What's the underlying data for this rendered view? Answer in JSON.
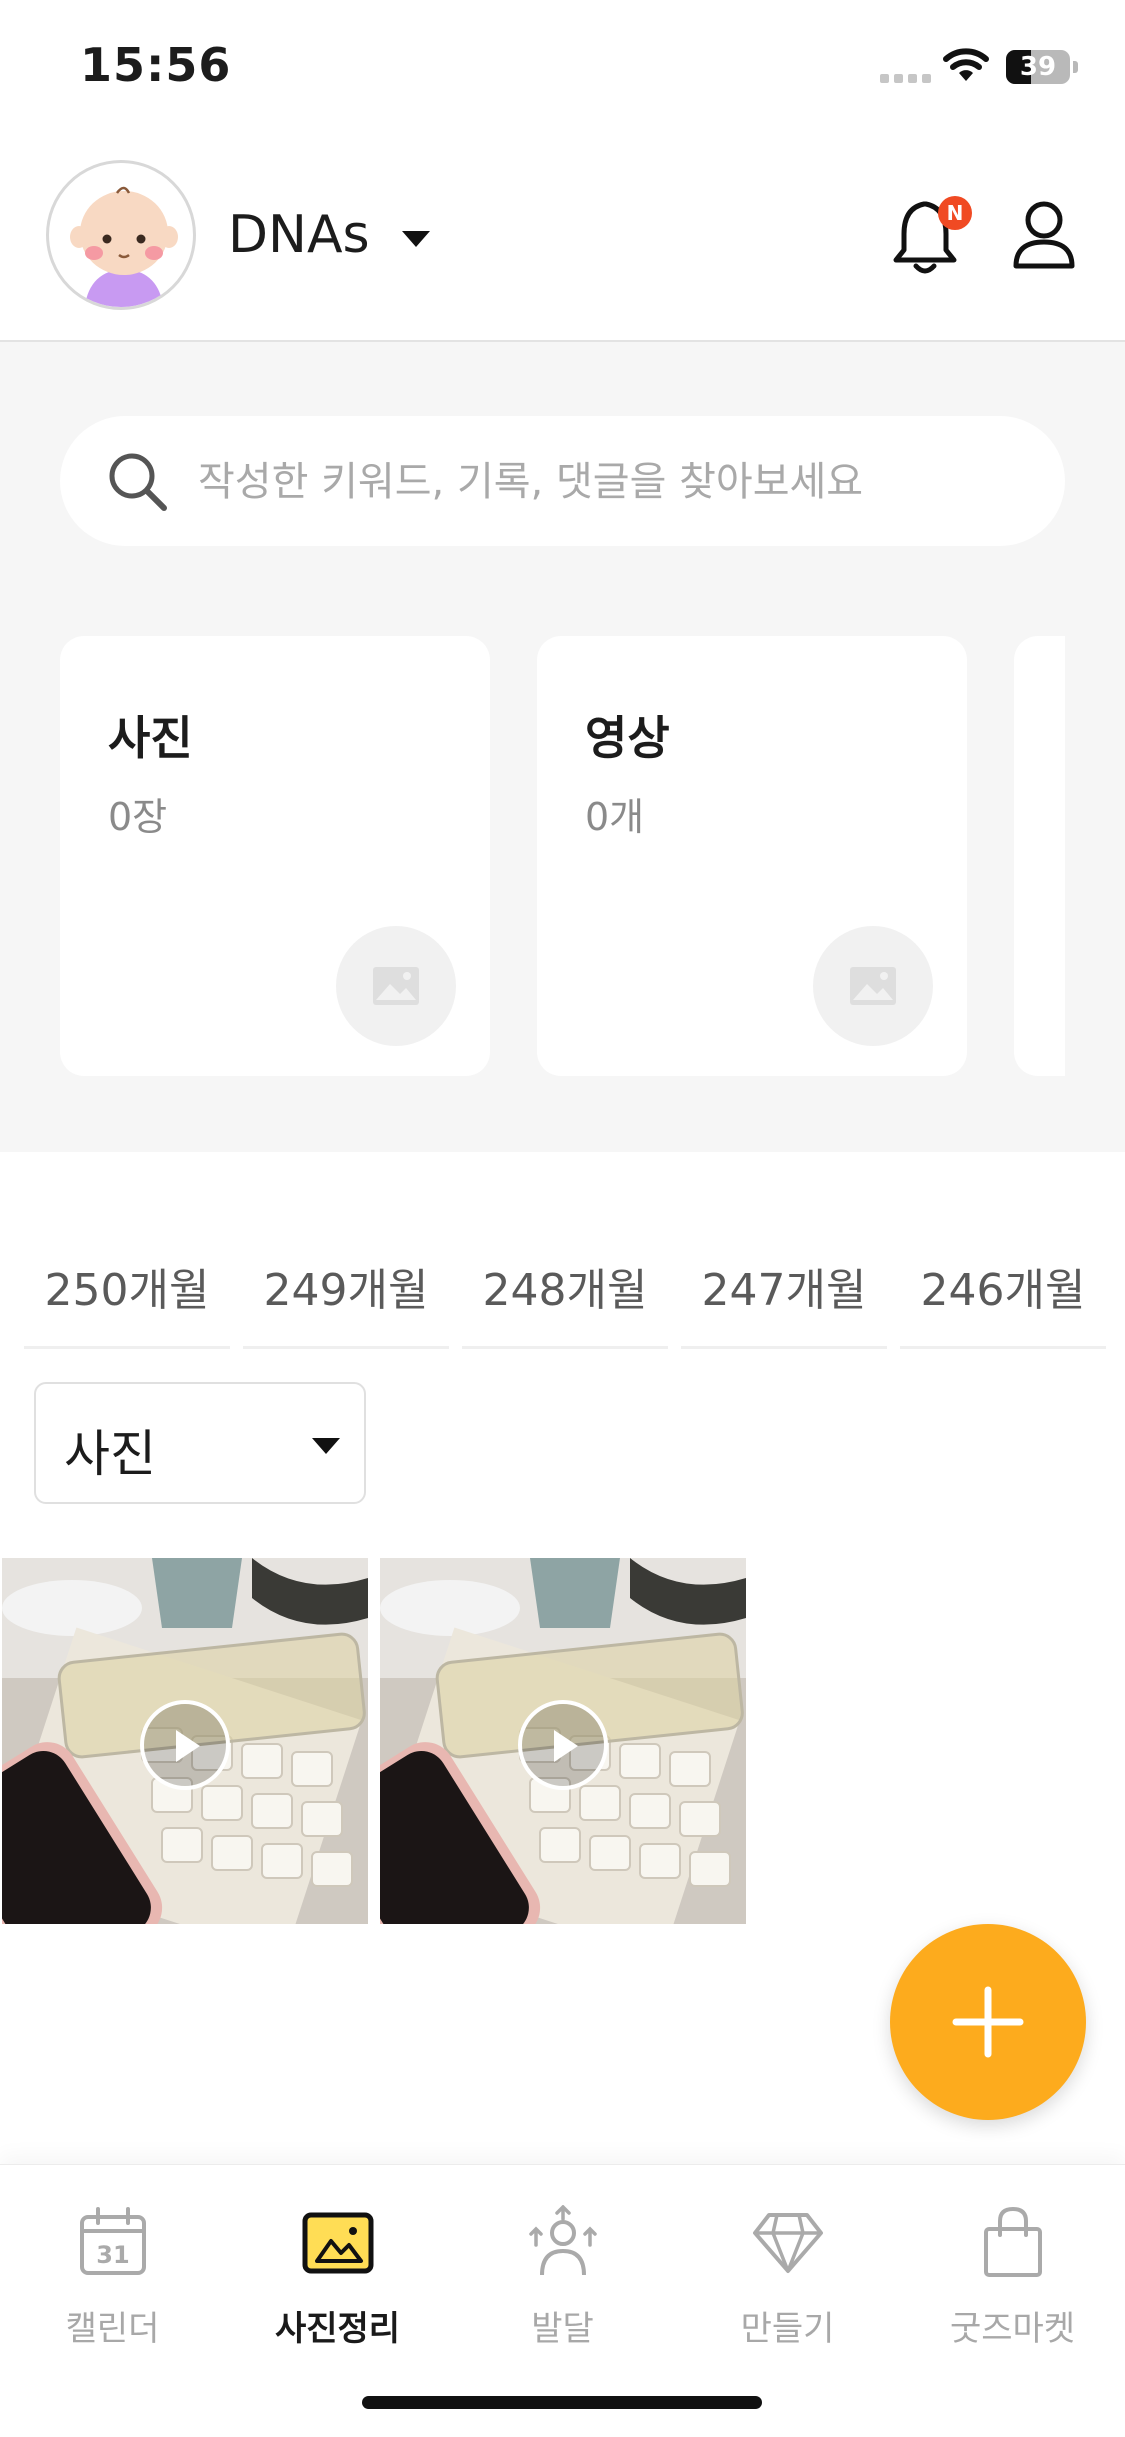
{
  "status_bar": {
    "time": "15:56",
    "battery": "39"
  },
  "header": {
    "profile_name": "DNAs",
    "notification_badge": "N"
  },
  "search": {
    "placeholder": "작성한 키워드, 기록, 댓글을 찾아보세요"
  },
  "cards": [
    {
      "title": "사진",
      "count": "0장"
    },
    {
      "title": "영상",
      "count": "0개"
    }
  ],
  "month_tabs": [
    "250개월",
    "249개월",
    "248개월",
    "247개월",
    "246개월"
  ],
  "filter": {
    "selected": "사진"
  },
  "media": [
    {
      "type": "video"
    },
    {
      "type": "video"
    }
  ],
  "tab_bar": {
    "items": [
      {
        "label": "캘린더",
        "icon": "calendar-icon",
        "calendar_day": "31"
      },
      {
        "label": "사진정리",
        "icon": "photo-icon"
      },
      {
        "label": "발달",
        "icon": "growth-icon"
      },
      {
        "label": "만들기",
        "icon": "diamond-icon"
      },
      {
        "label": "굿즈마켓",
        "icon": "shopping-bag-icon"
      }
    ],
    "active": "사진정리"
  },
  "colors": {
    "accent": "#fdab1d",
    "badge": "#f04a23",
    "gray_bg": "#f6f6f6"
  }
}
